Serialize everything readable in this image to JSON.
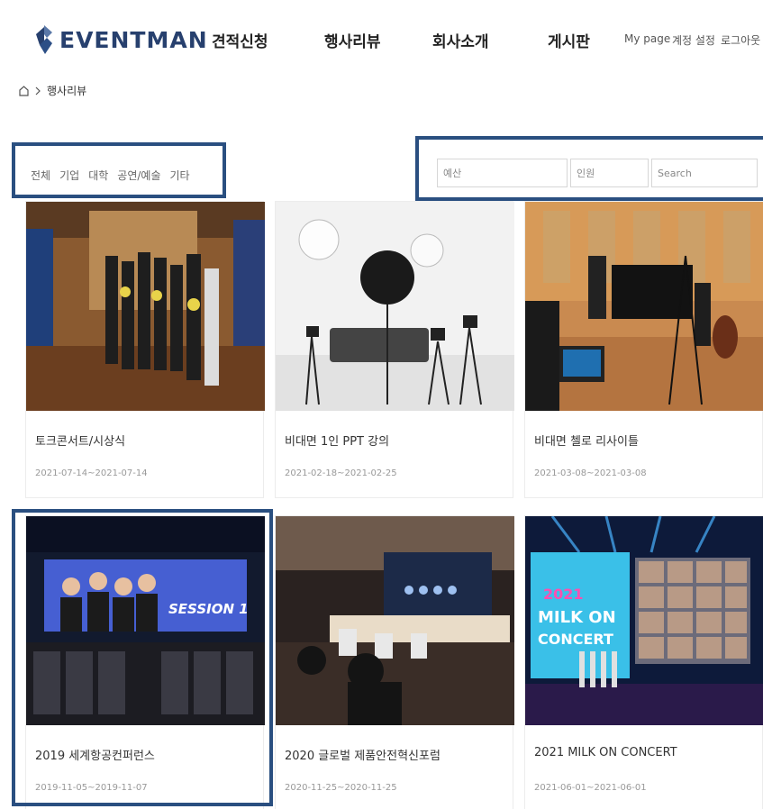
{
  "header": {
    "logo_text": "EVENTMAN",
    "nav": [
      "견적신청",
      "행사리뷰",
      "회사소개",
      "게시판"
    ],
    "util": [
      "My page",
      "계정 설정",
      "로그아웃"
    ]
  },
  "breadcrumb": {
    "current": "행사리뷰"
  },
  "filters": {
    "categories": [
      "전체",
      "기업",
      "대학",
      "공연/예술",
      "기타"
    ],
    "budget_placeholder": "예산",
    "people_placeholder": "인원",
    "search_placeholder": "Search"
  },
  "cards": [
    {
      "title": "토크콘서트/시상식",
      "date": "2021-07-14~2021-07-14"
    },
    {
      "title": "비대면 1인 PPT 강의",
      "date": "2021-02-18~2021-02-25"
    },
    {
      "title": "비대면 첼로 리사이틀",
      "date": "2021-03-08~2021-03-08"
    },
    {
      "title": "2019 세계항공컨퍼런스",
      "date": "2019-11-05~2019-11-07",
      "thumb_text": "SESSION 1"
    },
    {
      "title": "2020 글로벌 제품안전혁신포럼",
      "date": "2020-11-25~2020-11-25"
    },
    {
      "title": "2021 MILK ON CONCERT",
      "date": "2021-06-01~2021-06-01",
      "thumb_text": [
        "2021",
        "MILK ON",
        "CONCERT"
      ]
    }
  ],
  "colors": {
    "brand": "#27406e",
    "highlight_border": "#2a4f80"
  },
  "icons": {
    "home": "home-icon",
    "breadcrumb_sep": "chevron-right-icon",
    "logo": "logo-mark-icon"
  }
}
